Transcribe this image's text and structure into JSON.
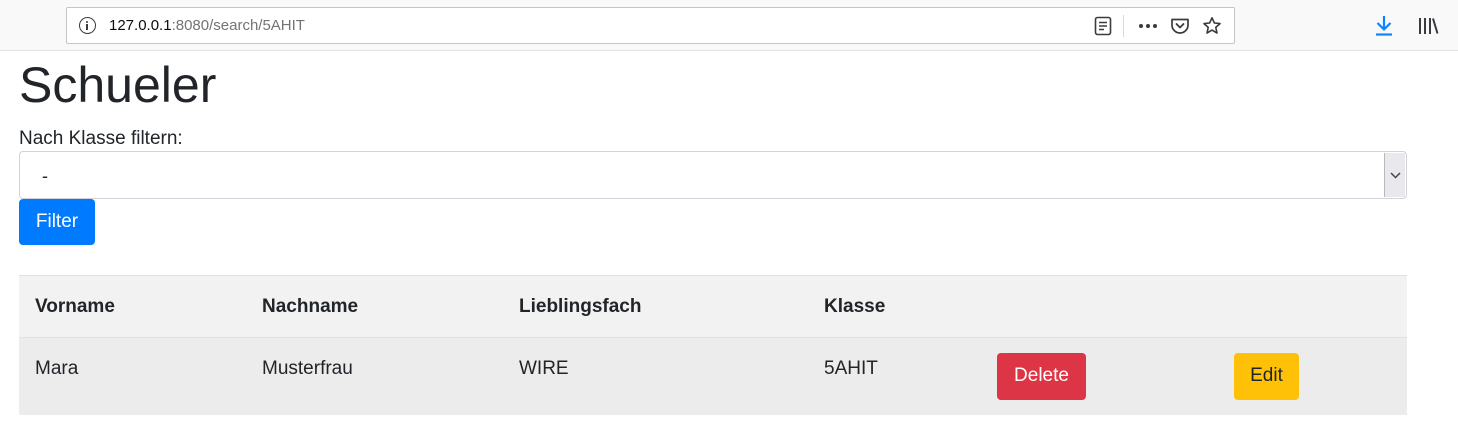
{
  "browser": {
    "url_host": "127.0.0.1",
    "url_rest": ":8080/search/5AHIT",
    "icons": [
      "info-icon",
      "reader-view-icon",
      "more-icon",
      "pocket-icon",
      "bookmark-star-icon",
      "download-icon",
      "library-icon"
    ],
    "download_color": "#0a84ff"
  },
  "page": {
    "title": "Schueler",
    "filter_label": "Nach Klasse filtern:",
    "select_value": "-",
    "filter_button": "Filter"
  },
  "table": {
    "headers": [
      "Vorname",
      "Nachname",
      "Lieblingsfach",
      "Klasse"
    ],
    "rows": [
      {
        "vorname": "Mara",
        "nachname": "Musterfrau",
        "lieblingsfach": "WIRE",
        "klasse": "5AHIT",
        "delete_label": "Delete",
        "edit_label": "Edit"
      }
    ]
  },
  "colors": {
    "primary": "#007bff",
    "danger": "#dc3545",
    "warning": "#ffc107"
  }
}
